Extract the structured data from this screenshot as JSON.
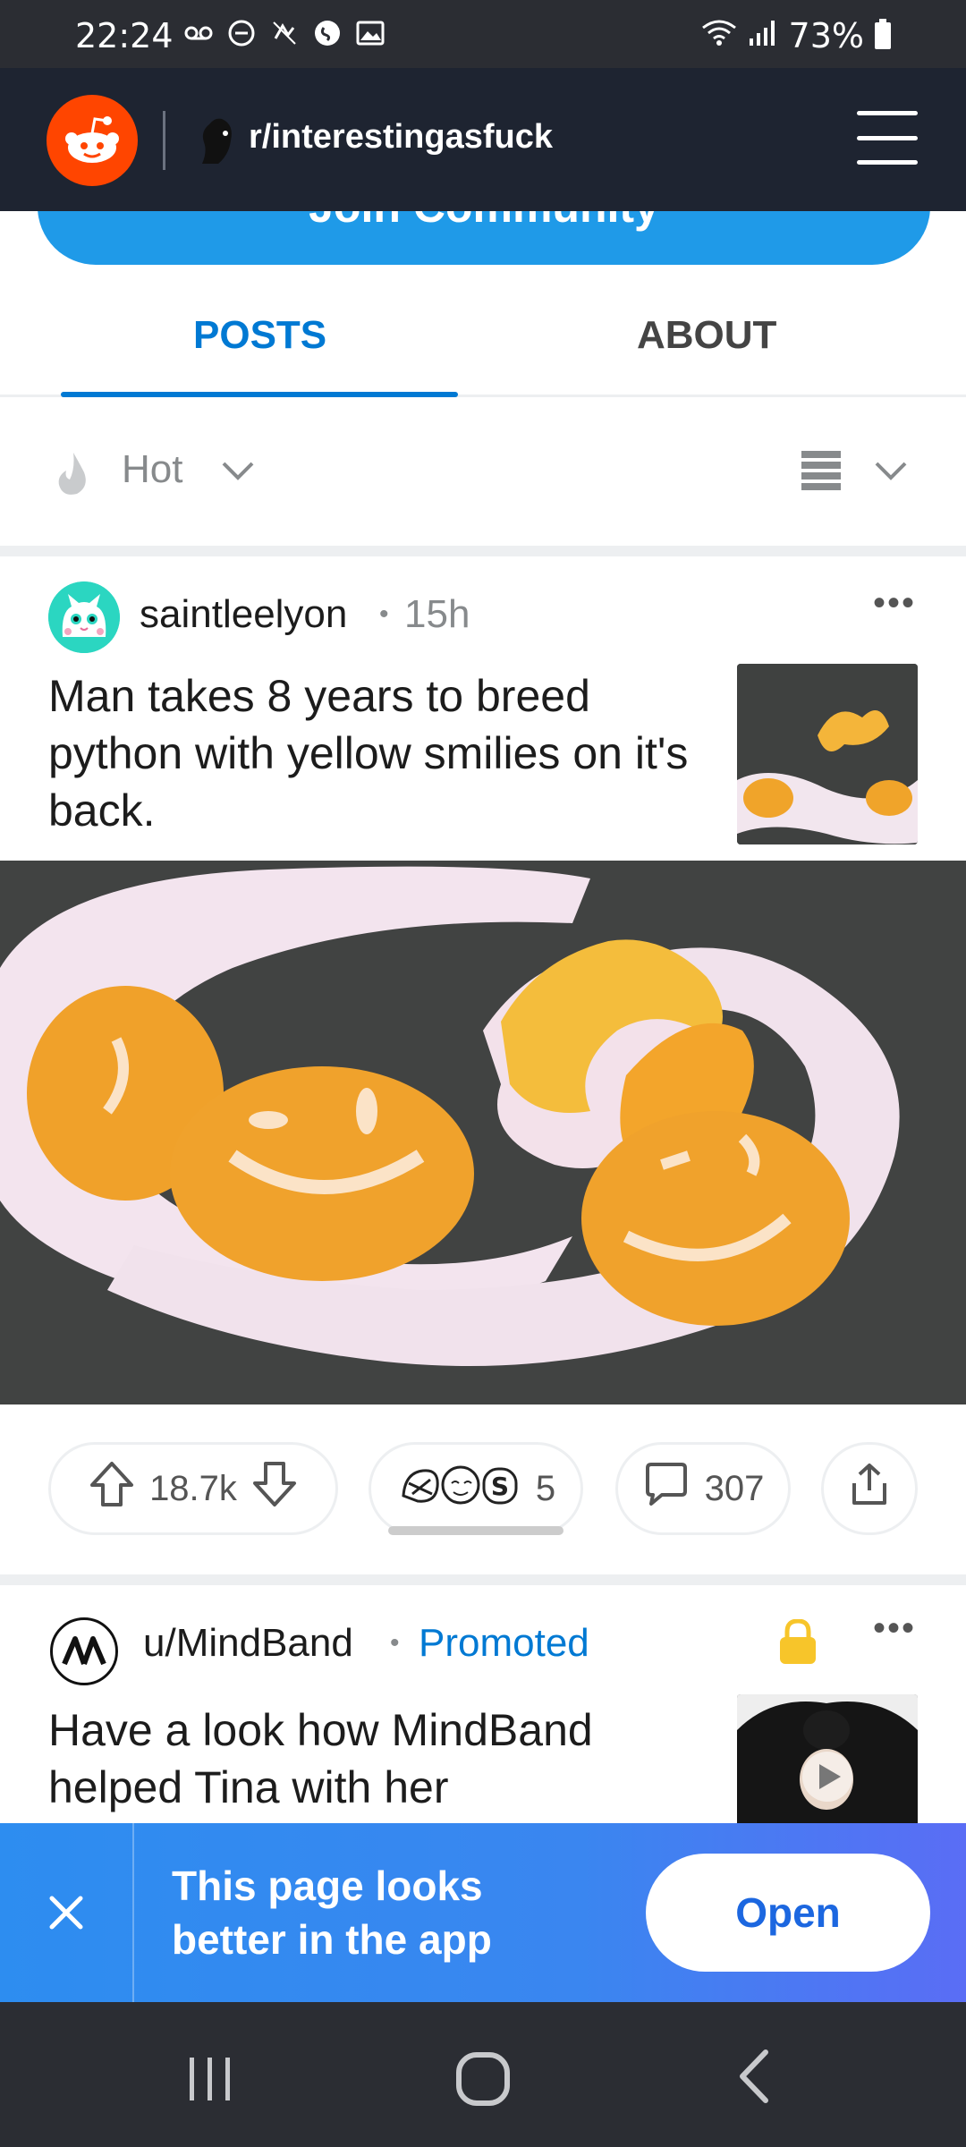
{
  "status_bar": {
    "time": "22:24",
    "battery": "73%"
  },
  "header": {
    "subreddit": "r/interestingasfuck"
  },
  "join_button": {
    "label": "Join Community"
  },
  "tabs": [
    {
      "label": "POSTS",
      "active": true
    },
    {
      "label": "ABOUT",
      "active": false
    }
  ],
  "sort": {
    "label": "Hot"
  },
  "post": {
    "author": "saintleelyon",
    "time": "15h",
    "title": "Man takes 8 years to breed python with yellow smilies on it's back.",
    "votes": "18.7k",
    "awards_count": "5",
    "comments": "307"
  },
  "promoted_post": {
    "author": "u/MindBand",
    "label": "Promoted",
    "title": "Have a look how MindBand helped Tina with her"
  },
  "app_banner": {
    "text": "This page looks better in the app",
    "button": "Open"
  },
  "colors": {
    "accent": "#0079d3",
    "header_bg": "#1e2431",
    "reddit_orange": "#ff4500",
    "banner_blue": "#2d8df0"
  }
}
